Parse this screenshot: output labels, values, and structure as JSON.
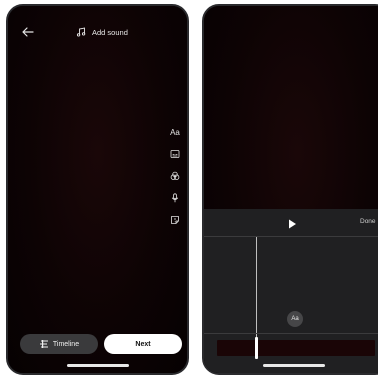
{
  "left_screen": {
    "top_bar": {
      "back_icon": "arrow-left-icon",
      "add_sound_label": "Add sound",
      "add_sound_icon": "music-note-icon"
    },
    "tools": [
      {
        "name": "text-tool",
        "label": "Aa",
        "icon": "text-icon"
      },
      {
        "name": "caption-tool",
        "label": "",
        "icon": "caption-icon"
      },
      {
        "name": "filters-tool",
        "label": "",
        "icon": "filters-icon"
      },
      {
        "name": "voiceover-tool",
        "label": "",
        "icon": "microphone-icon"
      },
      {
        "name": "sticker-tool",
        "label": "",
        "icon": "sticker-icon"
      }
    ],
    "bottom": {
      "timeline_label": "Timeline",
      "timeline_icon": "timeline-icon",
      "next_label": "Next"
    }
  },
  "right_screen": {
    "editor": {
      "play_icon": "play-icon",
      "done_label": "Done",
      "text_bubble_label": "Aa"
    }
  },
  "colors": {
    "canvas_dark": "#0d0304",
    "panel_bg": "#202022",
    "button_dark": "#3a3a3c",
    "button_light": "#ffffff",
    "track_fill": "#1a0506"
  }
}
